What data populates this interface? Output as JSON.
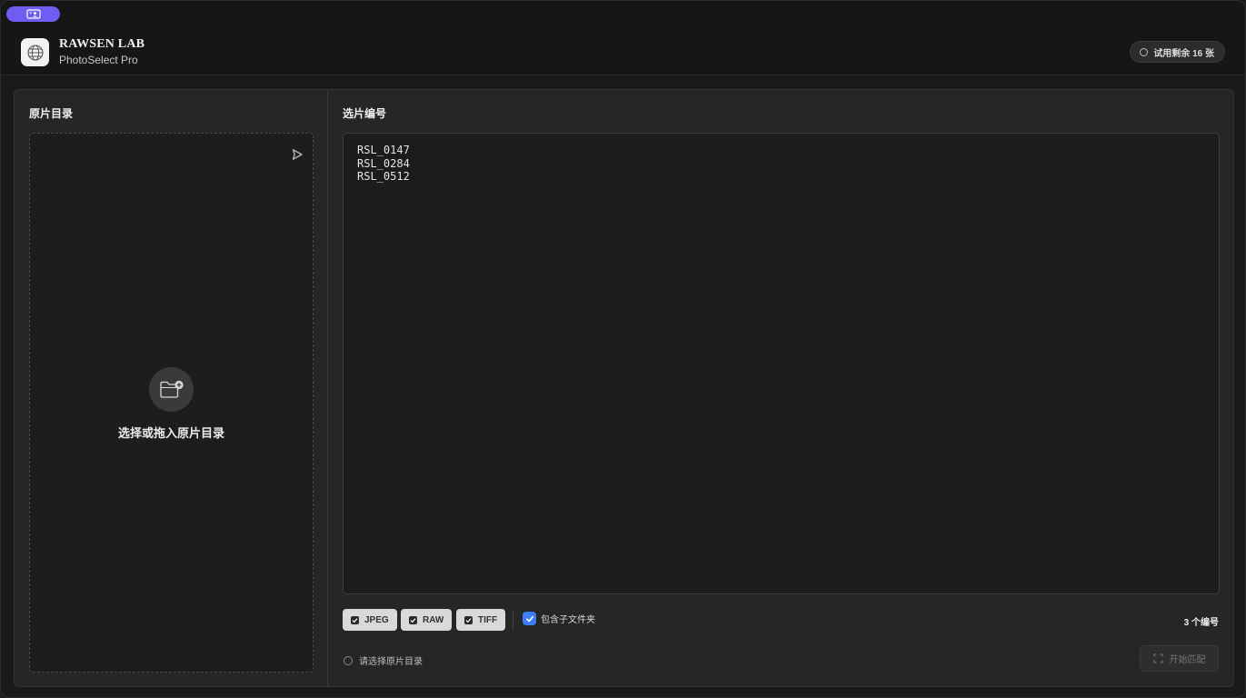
{
  "header": {
    "brand_title": "RAWSEN LAB",
    "brand_subtitle": "PhotoSelect Pro",
    "trial_badge": "试用剩余 16 张",
    "accent_color": "#6f5cf0"
  },
  "left_panel": {
    "title": "原片目录",
    "dropzone_label": "选择或拖入原片目录",
    "dropzone_icon": "folder-add-icon",
    "corner_icon": "cursor-arrow-icon"
  },
  "right_panel": {
    "title": "选片编号",
    "codes_text": "RSL_0147\nRSL_0284\nRSL_0512",
    "formats": [
      {
        "label": "JPEG",
        "checked": true
      },
      {
        "label": "RAW",
        "checked": true
      },
      {
        "label": "TIFF",
        "checked": true
      }
    ],
    "subfolder_label": "包含子文件夹",
    "subfolder_checked": true,
    "subfolder_color": "#3d7df5",
    "count_label": "3  个编号",
    "status_text": "请选择原片目录",
    "start_button": "开始匹配"
  }
}
